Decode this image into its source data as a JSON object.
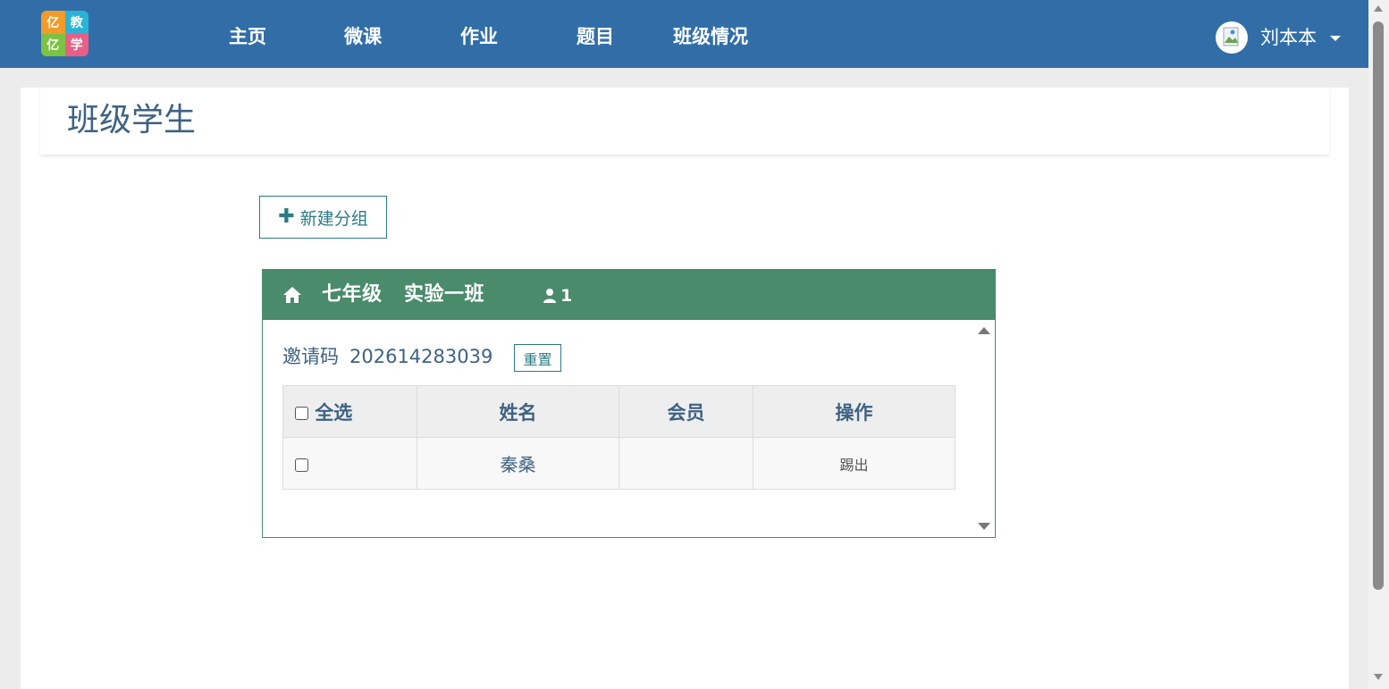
{
  "brand": {
    "logo_chars": [
      "亿",
      "教",
      "亿",
      "学"
    ],
    "colors": [
      "#f39a2a",
      "#2ab3d6",
      "#7cc243",
      "#e75f86"
    ]
  },
  "nav": {
    "items": [
      "主页",
      "微课",
      "作业",
      "题目",
      "班级情况"
    ],
    "user_name": "刘本本",
    "background": "#316ea8"
  },
  "page": {
    "title": "班级学生",
    "new_group_label": "新建分组"
  },
  "class_panel": {
    "class_name": "七年级   实验一班",
    "member_count": "1",
    "header_color": "#4a8b6c",
    "invite_label": "邀请码",
    "invite_code": "202614283039",
    "reset_label": "重置",
    "table": {
      "headers": [
        "全选",
        "姓名",
        "会员",
        "操作"
      ],
      "rows": [
        {
          "name": "秦桑",
          "member": "",
          "action": "踢出"
        }
      ]
    }
  }
}
